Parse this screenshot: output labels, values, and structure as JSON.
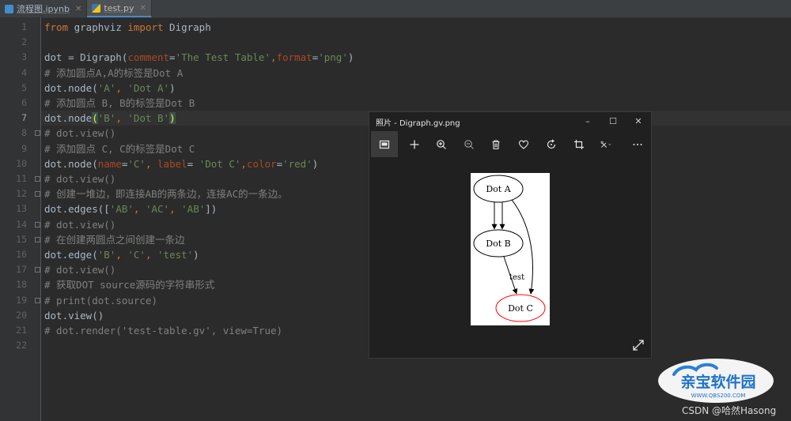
{
  "tabs": [
    {
      "label": "流程图.ipynb",
      "icon": "notebook-file-icon",
      "active": false
    },
    {
      "label": "test.py",
      "icon": "python-file-icon",
      "active": true
    }
  ],
  "editor": {
    "current_line": 7,
    "line_numbers": [
      "1",
      "2",
      "3",
      "4",
      "5",
      "6",
      "7",
      "8",
      "9",
      "10",
      "11",
      "12",
      "13",
      "14",
      "15",
      "16",
      "17",
      "18",
      "19",
      "20",
      "21",
      "22"
    ],
    "lines": [
      [
        [
          "kw",
          "from"
        ],
        [
          "id",
          " graphviz "
        ],
        [
          "kw",
          "import"
        ],
        [
          "id",
          " Digraph"
        ]
      ],
      [],
      [
        [
          "id",
          "dot = Digraph("
        ],
        [
          "pa",
          "comment"
        ],
        [
          "id",
          "="
        ],
        [
          "str",
          "'The Test Table'"
        ],
        [
          "sep",
          ","
        ],
        [
          "pa",
          "format"
        ],
        [
          "id",
          "="
        ],
        [
          "str",
          "'png'"
        ],
        [
          "id",
          ")"
        ]
      ],
      [
        [
          "cm",
          "# 添加圆点A,A的标签是Dot A"
        ]
      ],
      [
        [
          "id",
          "dot.node("
        ],
        [
          "str",
          "'A'"
        ],
        [
          "sep",
          ", "
        ],
        [
          "str",
          "'Dot A'"
        ],
        [
          "id",
          ")"
        ]
      ],
      [
        [
          "cm",
          "# 添加圆点 B, B的标签是Dot B"
        ]
      ],
      [
        [
          "id",
          "dot.node"
        ],
        [
          "br",
          "("
        ],
        [
          "str",
          "'B'"
        ],
        [
          "sep",
          ", "
        ],
        [
          "str",
          "'Dot B'"
        ],
        [
          "br",
          ")"
        ]
      ],
      [
        [
          "cm",
          "# dot.view()"
        ]
      ],
      [
        [
          "cm",
          "# 添加圆点 C, C的标签是Dot C"
        ]
      ],
      [
        [
          "id",
          "dot.node("
        ],
        [
          "pa",
          "name"
        ],
        [
          "id",
          "="
        ],
        [
          "str",
          "'C'"
        ],
        [
          "sep",
          ", "
        ],
        [
          "pa",
          "label"
        ],
        [
          "id",
          "= "
        ],
        [
          "str",
          "'Dot C'"
        ],
        [
          "sep",
          ","
        ],
        [
          "pa",
          "color"
        ],
        [
          "id",
          "="
        ],
        [
          "str",
          "'red'"
        ],
        [
          "id",
          ")"
        ]
      ],
      [
        [
          "cm",
          "# dot.view()"
        ]
      ],
      [
        [
          "cm",
          "# 创建一堆边，即连接AB的两条边，连接AC的一条边。"
        ]
      ],
      [
        [
          "id",
          "dot.edges(["
        ],
        [
          "str",
          "'AB'"
        ],
        [
          "sep",
          ", "
        ],
        [
          "str",
          "'AC'"
        ],
        [
          "sep",
          ", "
        ],
        [
          "str",
          "'AB'"
        ],
        [
          "id",
          "])"
        ]
      ],
      [
        [
          "cm",
          "# dot.view()"
        ]
      ],
      [
        [
          "cm",
          "# 在创建两圆点之间创建一条边"
        ]
      ],
      [
        [
          "id",
          "dot.edge("
        ],
        [
          "str",
          "'B'"
        ],
        [
          "sep",
          ", "
        ],
        [
          "str",
          "'C'"
        ],
        [
          "sep",
          ", "
        ],
        [
          "str",
          "'test'"
        ],
        [
          "id",
          ")"
        ]
      ],
      [
        [
          "cm",
          "# dot.view()"
        ]
      ],
      [
        [
          "cm",
          "# 获取DOT source源码的字符串形式"
        ]
      ],
      [
        [
          "cm",
          "# print(dot.source)"
        ]
      ],
      [
        [
          "id",
          "dot.view()"
        ]
      ],
      [
        [
          "cm",
          "# dot.render('test-table.gv', view=True)"
        ]
      ],
      []
    ],
    "fold_markers": [
      8,
      11,
      12,
      14,
      15,
      17,
      19
    ]
  },
  "photos_window": {
    "title": "照片 - Digraph.gv.png",
    "window_buttons": {
      "minimize": "–",
      "maximize": "☐",
      "close": "✕"
    },
    "toolbar_icons": [
      "image-gallery-icon",
      "add-icon",
      "zoom-in-icon",
      "zoom-out-icon",
      "delete-icon",
      "favorite-heart-icon",
      "rotate-icon",
      "crop-icon",
      "edit-tools-icon",
      "more-options-icon"
    ],
    "graph": {
      "nodes": {
        "a": "Dot A",
        "b": "Dot B",
        "c": "Dot C"
      },
      "edge_label": "test",
      "node_c_color": "#ff0000"
    }
  },
  "watermark": {
    "logo_text": "亲宝软件园",
    "logo_url": "WWW.QBS200.COM",
    "credit": "CSDN @哈然Hasong"
  },
  "colors": {
    "editor_bg": "#2b2b2b",
    "keyword": "#cc7832",
    "string": "#6a8759",
    "comment": "#808080",
    "param": "#aa4926"
  }
}
